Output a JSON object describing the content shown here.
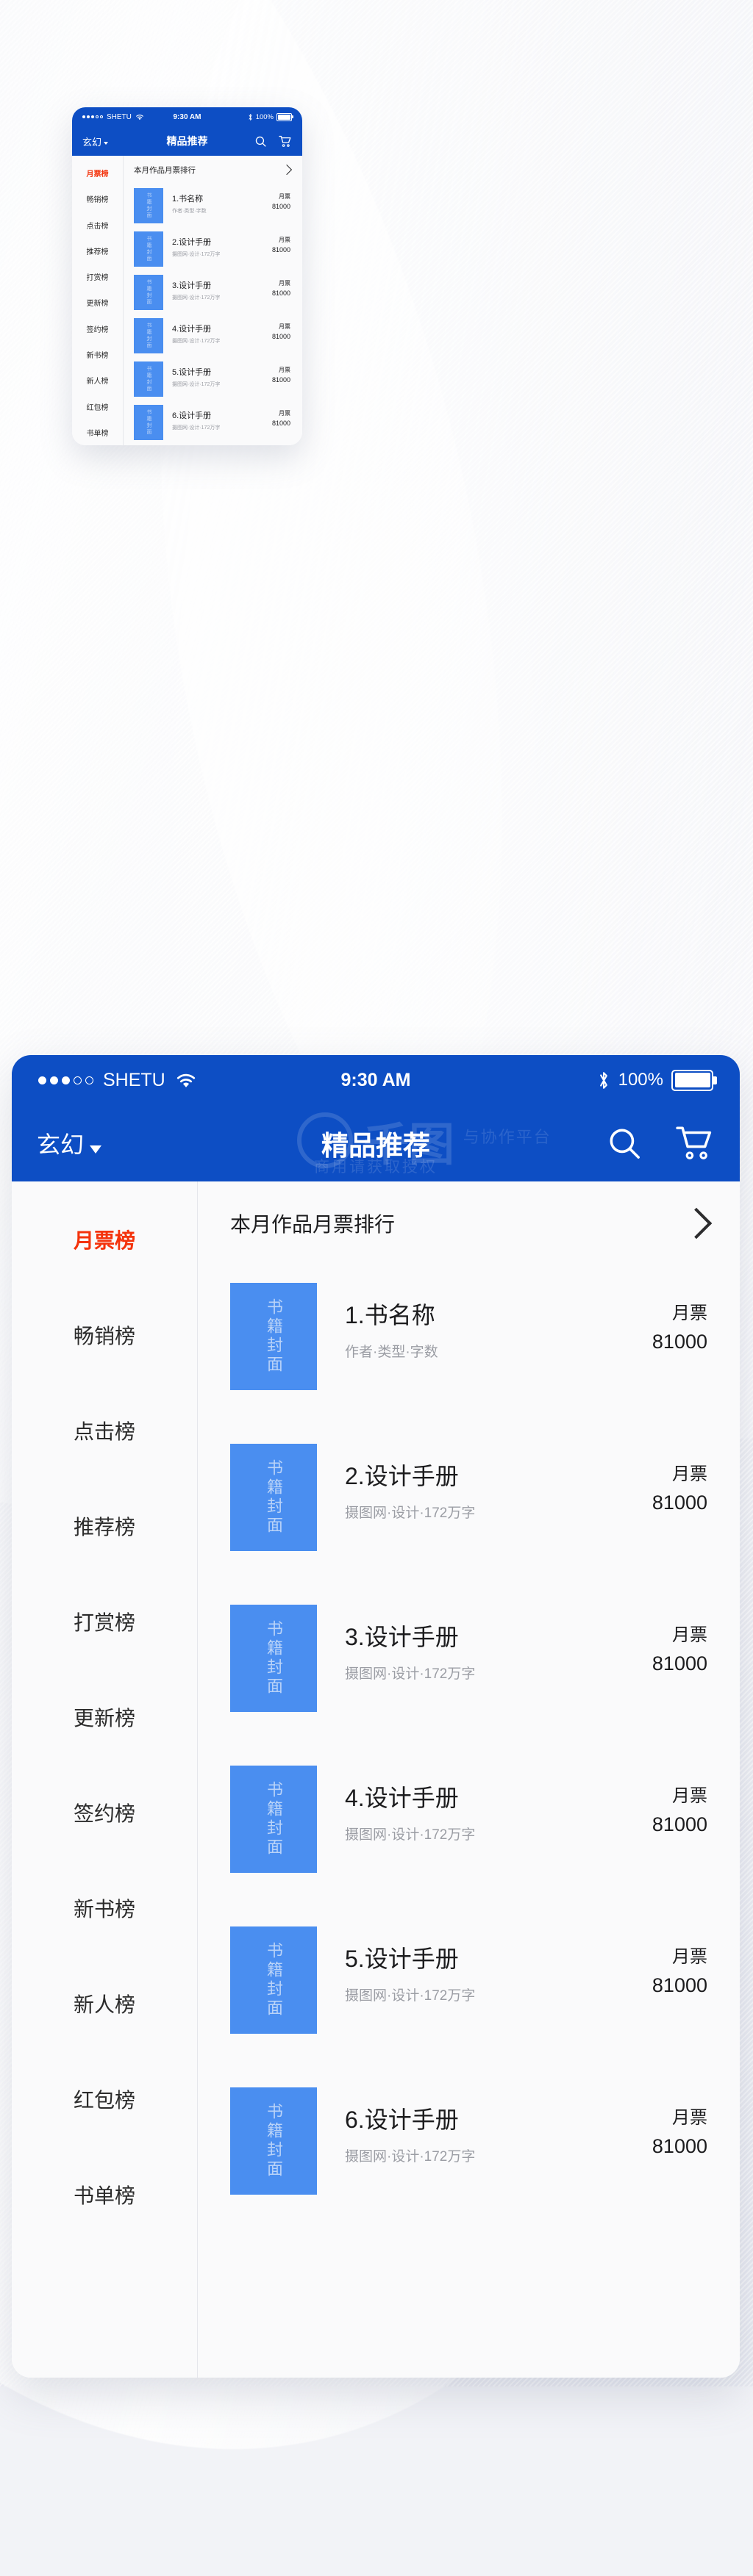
{
  "colors": {
    "brand_blue": "#0d4ec4",
    "cover_blue": "#4a8ef0",
    "active_red": "#f4330c",
    "panel_bg": "#fafafb"
  },
  "status_bar": {
    "carrier": "SHETU",
    "time": "9:30 AM",
    "battery_percent": "100%",
    "signal_icon": "signal-dots-icon",
    "wifi_icon": "wifi-icon",
    "bluetooth_icon": "bluetooth-icon",
    "battery_icon": "battery-full-icon"
  },
  "nav_bar": {
    "category": "玄幻",
    "category_caret_icon": "chevron-down-icon",
    "title": "精品推荐",
    "search_icon": "search-icon",
    "cart_icon": "shopping-cart-icon"
  },
  "watermark": {
    "brand": "千图",
    "line1": "商用请获取授权",
    "line2": "与协作平台"
  },
  "sidebar": {
    "items": [
      {
        "label": "月票榜",
        "active": true
      },
      {
        "label": "畅销榜",
        "active": false
      },
      {
        "label": "点击榜",
        "active": false
      },
      {
        "label": "推荐榜",
        "active": false
      },
      {
        "label": "打赏榜",
        "active": false
      },
      {
        "label": "更新榜",
        "active": false
      },
      {
        "label": "签约榜",
        "active": false
      },
      {
        "label": "新书榜",
        "active": false
      },
      {
        "label": "新人榜",
        "active": false
      },
      {
        "label": "红包榜",
        "active": false
      },
      {
        "label": "书单榜",
        "active": false
      }
    ]
  },
  "section": {
    "heading": "本月作品月票排行",
    "more_icon": "chevron-right-icon"
  },
  "cover_placeholder": "书籍封面",
  "books": [
    {
      "title": "1.书名称",
      "meta": "作者·类型·字数",
      "vote_label": "月票",
      "vote_value": "81000"
    },
    {
      "title": "2.设计手册",
      "meta": "摄图网·设计·172万字",
      "vote_label": "月票",
      "vote_value": "81000"
    },
    {
      "title": "3.设计手册",
      "meta": "摄图网·设计·172万字",
      "vote_label": "月票",
      "vote_value": "81000"
    },
    {
      "title": "4.设计手册",
      "meta": "摄图网·设计·172万字",
      "vote_label": "月票",
      "vote_value": "81000"
    },
    {
      "title": "5.设计手册",
      "meta": "摄图网·设计·172万字",
      "vote_label": "月票",
      "vote_value": "81000"
    },
    {
      "title": "6.设计手册",
      "meta": "摄图网·设计·172万字",
      "vote_label": "月票",
      "vote_value": "81000"
    }
  ]
}
